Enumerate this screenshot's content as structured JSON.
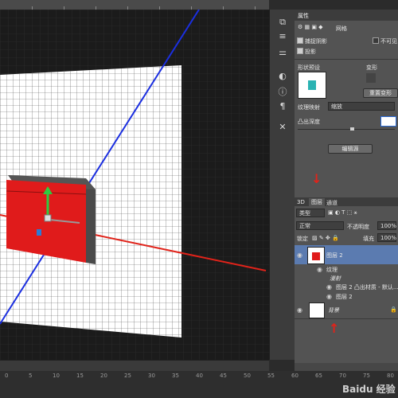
{
  "ruler_top": {
    "labels": [
      "",
      "",
      "",
      "",
      "",
      "",
      ""
    ]
  },
  "ruler_bottom": {
    "labels": [
      "0",
      "5",
      "10",
      "15",
      "20",
      "25",
      "30",
      "35",
      "40",
      "45",
      "50",
      "55",
      "60",
      "65",
      "70",
      "75",
      "80"
    ]
  },
  "toolstrip": {
    "icons": [
      "layers-icon",
      "sliders-icon",
      "sliders-alt-icon",
      "adjust-icon",
      "info-icon",
      "paragraph-icon",
      "tools-icon"
    ]
  },
  "properties": {
    "tab_label": "属性",
    "mode_label": "网格",
    "catch_shadow_label": "捕捉阴影",
    "unavail_label": "不可见",
    "cast_shadow_label": "投影",
    "shape_preset_label": "形状预设",
    "deform_label": "变形",
    "reset_deform_label": "重置变形",
    "texture_map_label": "纹理映射",
    "texture_map_value": "缩放",
    "extrude_depth_label": "凸出深度",
    "edit_source_label": "编辑源"
  },
  "layers_panel": {
    "tab_3d": "3D",
    "tab_layers": "图层",
    "tab_channels": "通道",
    "filter_label": "类型",
    "blend_mode": "正常",
    "opacity_label": "不透明度",
    "opacity_value": "100%",
    "lock_label": "锁定",
    "fill_label": "填充",
    "fill_value": "100%",
    "layers": [
      {
        "name": "图层 2"
      },
      {
        "name": "纹理"
      },
      {
        "name": "漫射"
      },
      {
        "name": "图层 2 凸出材质 - 默认..."
      },
      {
        "name": "图层 2"
      },
      {
        "name": "背景"
      }
    ]
  },
  "colors": {
    "accent_red": "#e0231a",
    "selection_blue": "#5b7bb0",
    "panel_bg": "#535353"
  },
  "watermark": "Baidu 经验"
}
